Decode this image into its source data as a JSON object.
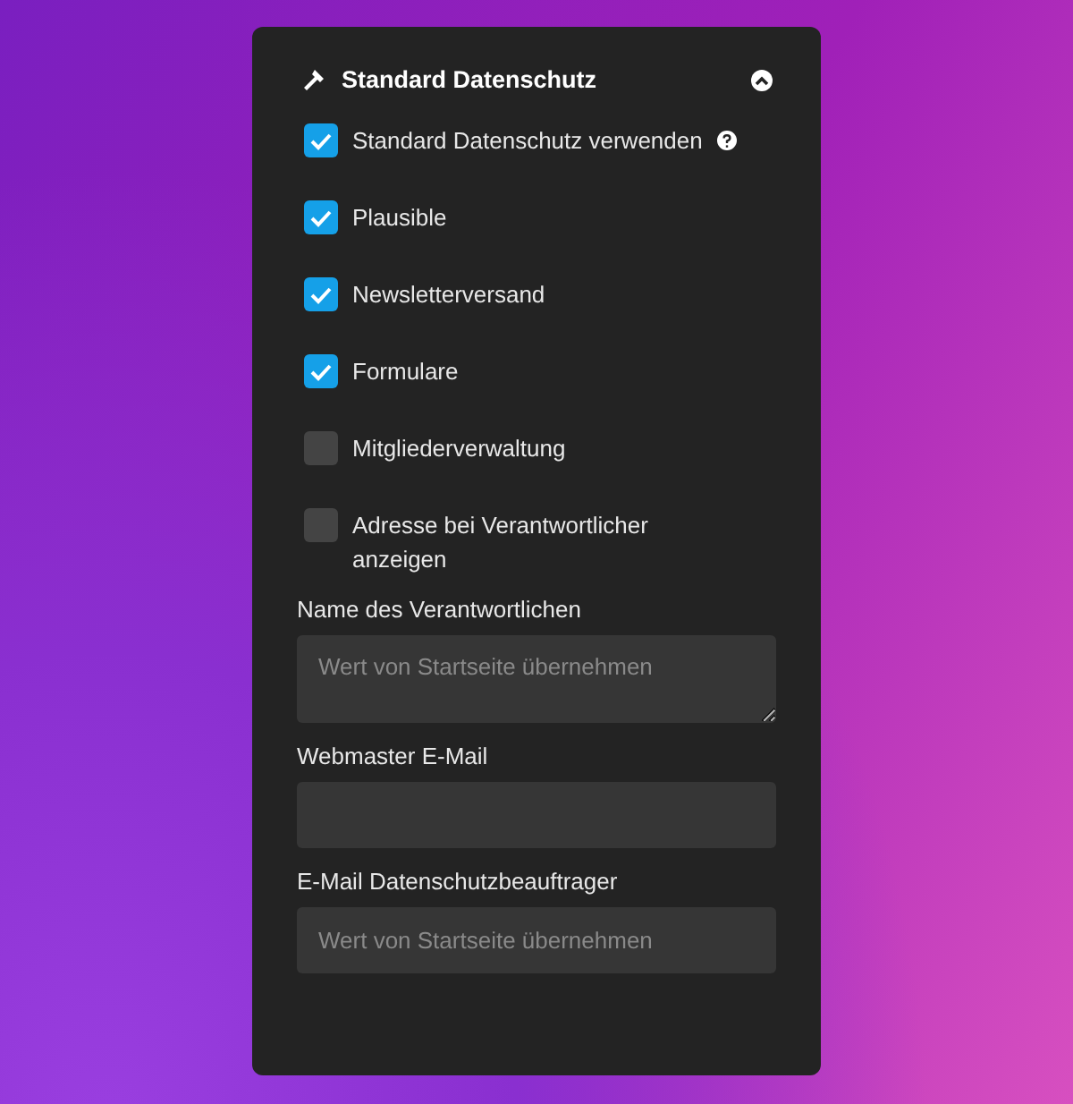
{
  "panel": {
    "title": "Standard Datenschutz",
    "expanded": true
  },
  "options": [
    {
      "label": "Standard Datenschutz verwenden",
      "checked": true,
      "help": true
    },
    {
      "label": "Plausible",
      "checked": true
    },
    {
      "label": "Newsletterversand",
      "checked": true
    },
    {
      "label": "Formulare",
      "checked": true
    },
    {
      "label": "Mitgliederverwaltung",
      "checked": false
    },
    {
      "label": "Adresse bei Verantwortlicher anzeigen",
      "checked": false
    }
  ],
  "fields": [
    {
      "kind": "textarea",
      "label": "Name des Verantwortlichen",
      "placeholder": "Wert von Startseite übernehmen"
    },
    {
      "kind": "input",
      "label": "Webmaster E-Mail"
    },
    {
      "kind": "input",
      "label": "E-Mail Datenschutzbeauftrager",
      "placeholder": "Wert von Startseite übernehmen"
    }
  ]
}
